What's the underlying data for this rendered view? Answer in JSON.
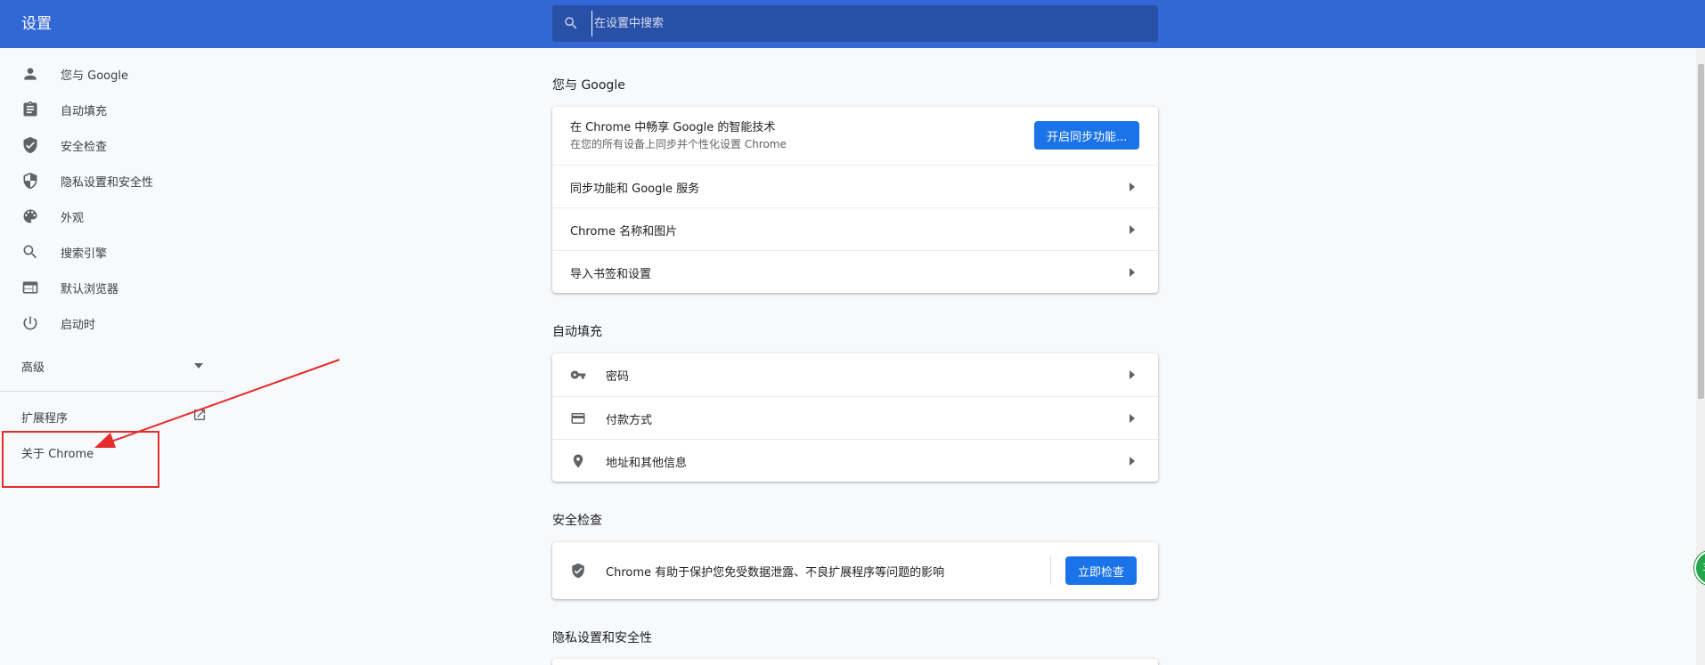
{
  "header": {
    "title": "设置",
    "search_placeholder": "在设置中搜索"
  },
  "sidebar": {
    "items": [
      {
        "label": "您与 Google",
        "icon": "person-icon"
      },
      {
        "label": "自动填充",
        "icon": "clipboard-icon"
      },
      {
        "label": "安全检查",
        "icon": "shield-check-icon"
      },
      {
        "label": "隐私设置和安全性",
        "icon": "shield-half-icon"
      },
      {
        "label": "外观",
        "icon": "palette-icon"
      },
      {
        "label": "搜索引擎",
        "icon": "search-icon"
      },
      {
        "label": "默认浏览器",
        "icon": "browser-icon"
      },
      {
        "label": "启动时",
        "icon": "power-icon"
      }
    ],
    "advanced_label": "高级",
    "extensions_label": "扩展程序",
    "about_label": "关于 Chrome"
  },
  "you_and_google": {
    "title": "您与 Google",
    "sync_title": "在 Chrome 中畅享 Google 的智能技术",
    "sync_subtitle": "在您的所有设备上同步并个性化设置 Chrome",
    "sync_button": "开启同步功能...",
    "rows": [
      "同步功能和 Google 服务",
      "Chrome 名称和图片",
      "导入书签和设置"
    ]
  },
  "autofill": {
    "title": "自动填充",
    "rows": [
      {
        "label": "密码",
        "icon": "key-icon"
      },
      {
        "label": "付款方式",
        "icon": "credit-card-icon"
      },
      {
        "label": "地址和其他信息",
        "icon": "location-pin-icon"
      }
    ]
  },
  "safety_check": {
    "title": "安全检查",
    "description": "Chrome 有助于保护您免受数据泄露、不良扩展程序等问题的影响",
    "button": "立即检查"
  },
  "privacy": {
    "title": "隐私设置和安全性"
  },
  "colors": {
    "header_bg": "#3367d6",
    "accent": "#1a73e8",
    "annotation": "#e52c2c"
  }
}
